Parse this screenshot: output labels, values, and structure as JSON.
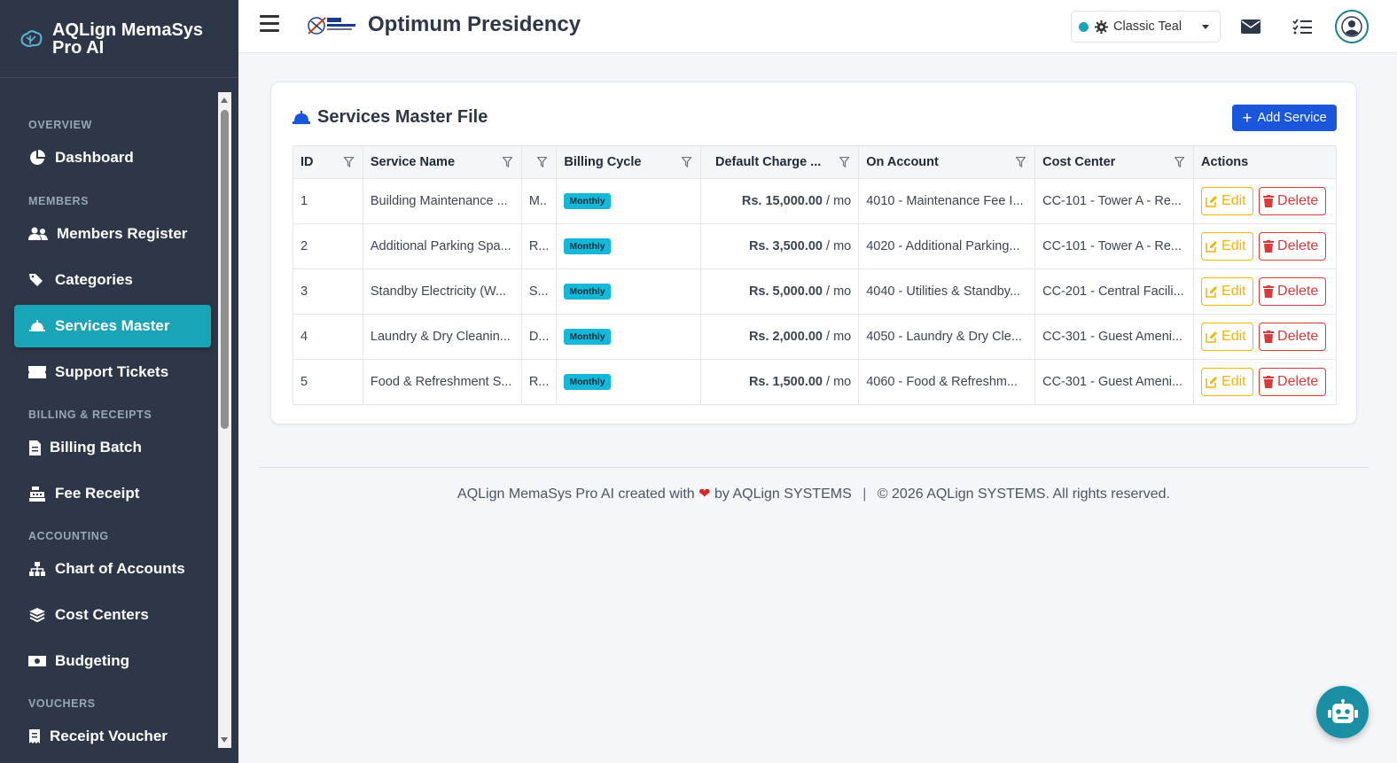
{
  "brand": {
    "title": "AQLign MemaSys Pro AI"
  },
  "sidebar": {
    "sections": {
      "overview": "OVERVIEW",
      "members": "MEMBERS",
      "billing": "BILLING & RECEIPTS",
      "accounting": "ACCOUNTING",
      "vouchers": "VOUCHERS"
    },
    "items": {
      "dashboard": "Dashboard",
      "members_register": "Members Register",
      "categories": "Categories",
      "services_master": "Services Master",
      "support_tickets": "Support Tickets",
      "billing_batch": "Billing Batch",
      "fee_receipt": "Fee Receipt",
      "chart_of_accounts": "Chart of Accounts",
      "cost_centers": "Cost Centers",
      "budgeting": "Budgeting",
      "receipt_voucher": "Receipt Voucher"
    },
    "active": "Services Master"
  },
  "topbar": {
    "org_title": "Optimum Presidency",
    "theme_label": "Classic Teal"
  },
  "card": {
    "title": "Services Master File",
    "add_button": "Add Service"
  },
  "table": {
    "headers": {
      "id": "ID",
      "service_name": "Service Name",
      "blank": "",
      "billing_cycle": "Billing Cycle",
      "default_charge": "Default Charge ...",
      "on_account": "On Account",
      "cost_center": "Cost Center",
      "actions": "Actions"
    },
    "rows": [
      {
        "id": "1",
        "name": "Building Maintenance ...",
        "short": "M..",
        "cycle": "Monthly",
        "amount": "Rs. 15,000.00",
        "per": " / mo",
        "account": "4010 - Maintenance Fee I...",
        "cost_center": "CC-101 - Tower A - Re...",
        "edit": "Edit",
        "delete": "Delete"
      },
      {
        "id": "2",
        "name": "Additional Parking Spa...",
        "short": "R...",
        "cycle": "Monthly",
        "amount": "Rs. 3,500.00",
        "per": " / mo",
        "account": "4020 - Additional Parking...",
        "cost_center": "CC-101 - Tower A - Re...",
        "edit": "Edit",
        "delete": "Delete"
      },
      {
        "id": "3",
        "name": "Standby Electricity (W...",
        "short": "S...",
        "cycle": "Monthly",
        "amount": "Rs. 5,000.00",
        "per": " / mo",
        "account": "4040 - Utilities & Standby...",
        "cost_center": "CC-201 - Central Facili...",
        "edit": "Edit",
        "delete": "Delete"
      },
      {
        "id": "4",
        "name": "Laundry & Dry Cleanin...",
        "short": "D...",
        "cycle": "Monthly",
        "amount": "Rs. 2,000.00",
        "per": " / mo",
        "account": "4050 - Laundry & Dry Cle...",
        "cost_center": "CC-301 - Guest Ameni...",
        "edit": "Edit",
        "delete": "Delete"
      },
      {
        "id": "5",
        "name": "Food & Refreshment S...",
        "short": "R...",
        "cycle": "Monthly",
        "amount": "Rs. 1,500.00",
        "per": " / mo",
        "account": "4060 - Food & Refreshm...",
        "cost_center": "CC-301 - Guest Ameni...",
        "edit": "Edit",
        "delete": "Delete"
      }
    ]
  },
  "footer": {
    "left_prefix": "AQLign MemaSys Pro AI created with",
    "left_suffix": "by AQLign SYSTEMS",
    "separator": "|",
    "right": "© 2026 AQLign SYSTEMS. All rights reserved."
  },
  "colors": {
    "accent": "#1aa4b8",
    "primary": "#1a56db",
    "warning": "#f4b400",
    "danger": "#d93a3a",
    "sidebar": "#2d3748"
  },
  "icons": [
    "brain-logo-icon",
    "chart-pie-icon",
    "users-icon",
    "tags-icon",
    "bell-concierge-icon",
    "ticket-icon",
    "file-invoice-icon",
    "cash-register-icon",
    "sitemap-icon",
    "layers-icon",
    "money-bill-icon",
    "receipt-icon",
    "hamburger-icon",
    "gear-icon",
    "envelope-icon",
    "tasks-icon",
    "user-circle-icon",
    "filter-icon",
    "edit-icon",
    "trash-icon",
    "heart-icon",
    "robot-icon"
  ]
}
